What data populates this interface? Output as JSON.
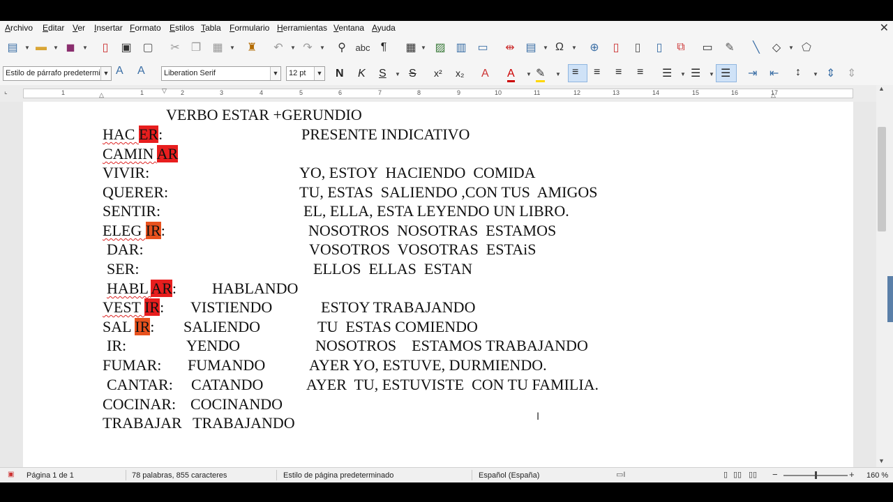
{
  "menu": [
    "Archivo",
    "Editar",
    "Ver",
    "Insertar",
    "Formato",
    "Estilos",
    "Tabla",
    "Formulario",
    "Herramientas",
    "Ventana",
    "Ayuda"
  ],
  "toolbar2": {
    "paragraph_style": "Estilo de párrafo predeterminado",
    "font_name": "Liberation Serif",
    "font_size": "12 pt",
    "bold": "N",
    "italic": "K",
    "underline": "S",
    "strike": "S"
  },
  "ruler_numbers": [
    "1",
    "1",
    "2",
    "3",
    "4",
    "5",
    "6",
    "7",
    "8",
    "9",
    "10",
    "11",
    "12",
    "13",
    "14",
    "15",
    "16",
    "17"
  ],
  "document": {
    "title": "VERBO ESTAR +GERUNDIO",
    "hacer_pre": "HAC ",
    "hacer_hl": "ER",
    "hacer_post": ":",
    "presente": "PRESENTE INDICATIVO",
    "caminar_pre": "CAMIN ",
    "caminar_hl": "AR",
    "vivir": "VIVIR:",
    "yo": "YO, ESTOY  HACIENDO  COMIDA",
    "querer": "QUERER:",
    "tu": "TU, ESTAS  SALIENDO ,CON TUS  AMIGOS",
    "sentir": "SENTIR:",
    "el": "EL, ELLA, ESTA LEYENDO UN LIBRO.",
    "elegir_pre": "ELEG ",
    "elegir_hl": "IR",
    "elegir_post": ":",
    "nosotros": "NOSOTROS  NOSOTRAS  ESTAMOS",
    "dar": "DAR:",
    "vosotros": "VOSOTROS  VOSOTRAS  ESTAiS",
    "ser": "SER:",
    "ellos": "ELLOS  ELLAS  ESTAN",
    "hablar_pre": "HABL ",
    "hablar_hl": "AR",
    "hablar_post": ":",
    "hablando": "HABLANDO",
    "vestir_pre": "VEST ",
    "vestir_hl": "IR",
    "vestir_post": ":",
    "vistiendo": "VISTIENDO",
    "estoy_trab": "ESTOY TRABAJANDO",
    "salir_pre": "SAL ",
    "salir_hl": "IR",
    "salir_post": ":",
    "saliendo": "SALIENDO",
    "tu_comiendo": "TU  ESTAS COMIENDO",
    "ir": "IR:",
    "yendo": "YENDO",
    "nos_trab": "NOSOTROS    ESTAMOS TRABAJANDO",
    "fumar": "FUMAR:",
    "fumando": "FUMANDO",
    "ayer_yo": "AYER YO, ESTUVE, DURMIENDO.",
    "cantar": "CANTAR:",
    "catando": "CATANDO",
    "ayer_tu": "AYER  TU, ESTUVISTE  CON TU FAMILIA.",
    "cocinar": "COCINAR:",
    "cocinando": "COCINANDO",
    "trabajar": "TRABAJAR",
    "trabajando": "TRABAJANDO"
  },
  "status": {
    "page": "Página 1 de 1",
    "words": "78 palabras, 855 caracteres",
    "page_style": "Estilo de página predeterminado",
    "language": "Español (España)",
    "zoom": "160 %"
  },
  "colors": {
    "highlight_red": "#e81e1e",
    "highlight_orange": "#e8521e",
    "active_button": "#cfe2f7"
  }
}
